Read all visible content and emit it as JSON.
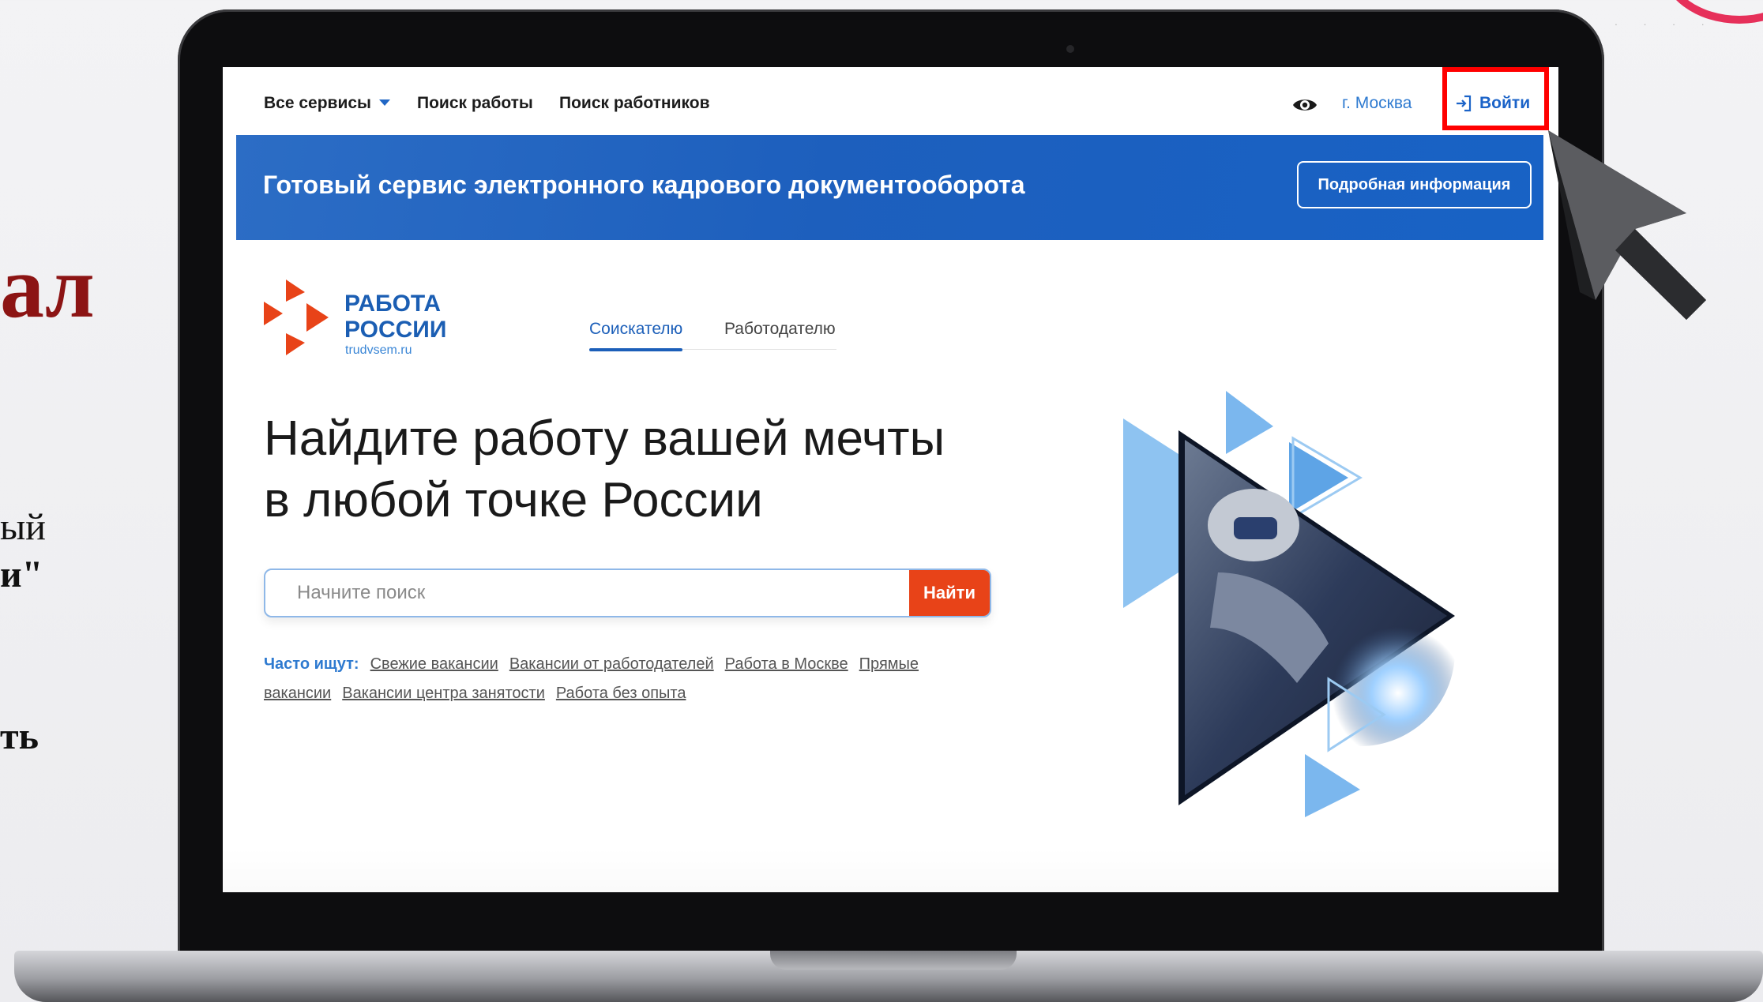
{
  "slide": {
    "title_fragment": "ал",
    "line1": "ый",
    "line2": "и\"",
    "line3": "ть"
  },
  "nav": {
    "all_services": "Все сервисы",
    "job_search": "Поиск работы",
    "worker_search": "Поиск работников",
    "city": "г. Москва",
    "login": "Войти"
  },
  "banner": {
    "text": "Готовый сервис электронного кадрового документооборота",
    "button": "Подробная информация"
  },
  "logo": {
    "line1": "РАБОТА",
    "line2": "РОССИИ",
    "site": "trudvsem.ru"
  },
  "tabs": {
    "seeker": "Соискателю",
    "employer": "Работодателю"
  },
  "hero": {
    "line1": "Найдите работу вашей мечты",
    "line2": "в любой точке России"
  },
  "search": {
    "placeholder": "Начните поиск",
    "button": "Найти"
  },
  "popular": {
    "label": "Часто ищут:",
    "links": [
      "Свежие вакансии",
      "Вакансии от работодателей",
      "Работа в Москве",
      "Прямые",
      "вакансии",
      "Вакансии центра занятости",
      "Работа без опыта"
    ]
  },
  "colors": {
    "brand_blue": "#1c5fb9",
    "accent_orange": "#e84318",
    "highlight_red": "#ff0000"
  }
}
